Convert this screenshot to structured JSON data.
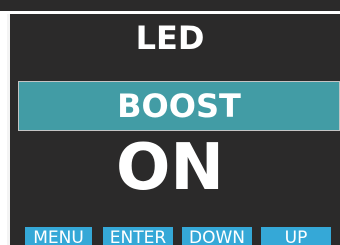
{
  "screen": {
    "title": "LED",
    "selected_item": "BOOST",
    "state": "ON"
  },
  "buttons": {
    "menu": "MENU",
    "enter": "ENTER",
    "down": "DOWN",
    "up": "UP"
  },
  "colors": {
    "background": "#2b2a2a",
    "highlight": "#429ca5",
    "button": "#35a8d7",
    "text": "#ffffff"
  }
}
